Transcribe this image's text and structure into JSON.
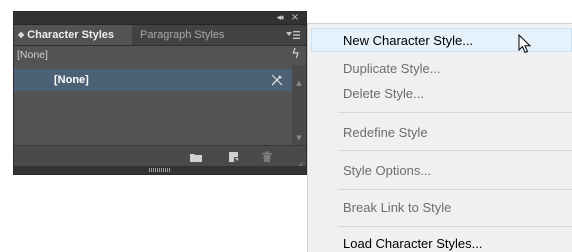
{
  "panel": {
    "collapse_glyph": "◂◂",
    "close_glyph": "×",
    "tabs": [
      {
        "label": "Character Styles",
        "active": true
      },
      {
        "label": "Paragraph Styles",
        "active": false
      }
    ],
    "current_style": "[None]",
    "list_items": [
      {
        "label": "[None]",
        "selected": true
      }
    ],
    "icons": [
      "tab-arrow-icon",
      "panel-menu-icon",
      "lightning-icon",
      "no-edit-icon",
      "folder-icon",
      "new-style-icon",
      "trash-icon",
      "resize-grip-icon",
      "drag-handle-icon"
    ],
    "colors": {
      "panel_bg": "#535353",
      "tabbar_bg": "#424242",
      "selected_row": "#4c6176"
    }
  },
  "menu": {
    "items": [
      {
        "label": "New Character Style...",
        "enabled": true,
        "hover": true
      },
      {
        "label": "Duplicate Style...",
        "enabled": false
      },
      {
        "label": "Delete Style...",
        "enabled": false
      },
      {
        "label": "Redefine Style",
        "enabled": false
      },
      {
        "label": "Style Options...",
        "enabled": false
      },
      {
        "label": "Break Link to Style",
        "enabled": false
      },
      {
        "label": "Load Character Styles...",
        "enabled": true
      }
    ],
    "colors": {
      "menu_bg": "#f0f0f0",
      "hover_bg": "#e5f1fb",
      "disabled_text": "#6d6d6d"
    }
  }
}
